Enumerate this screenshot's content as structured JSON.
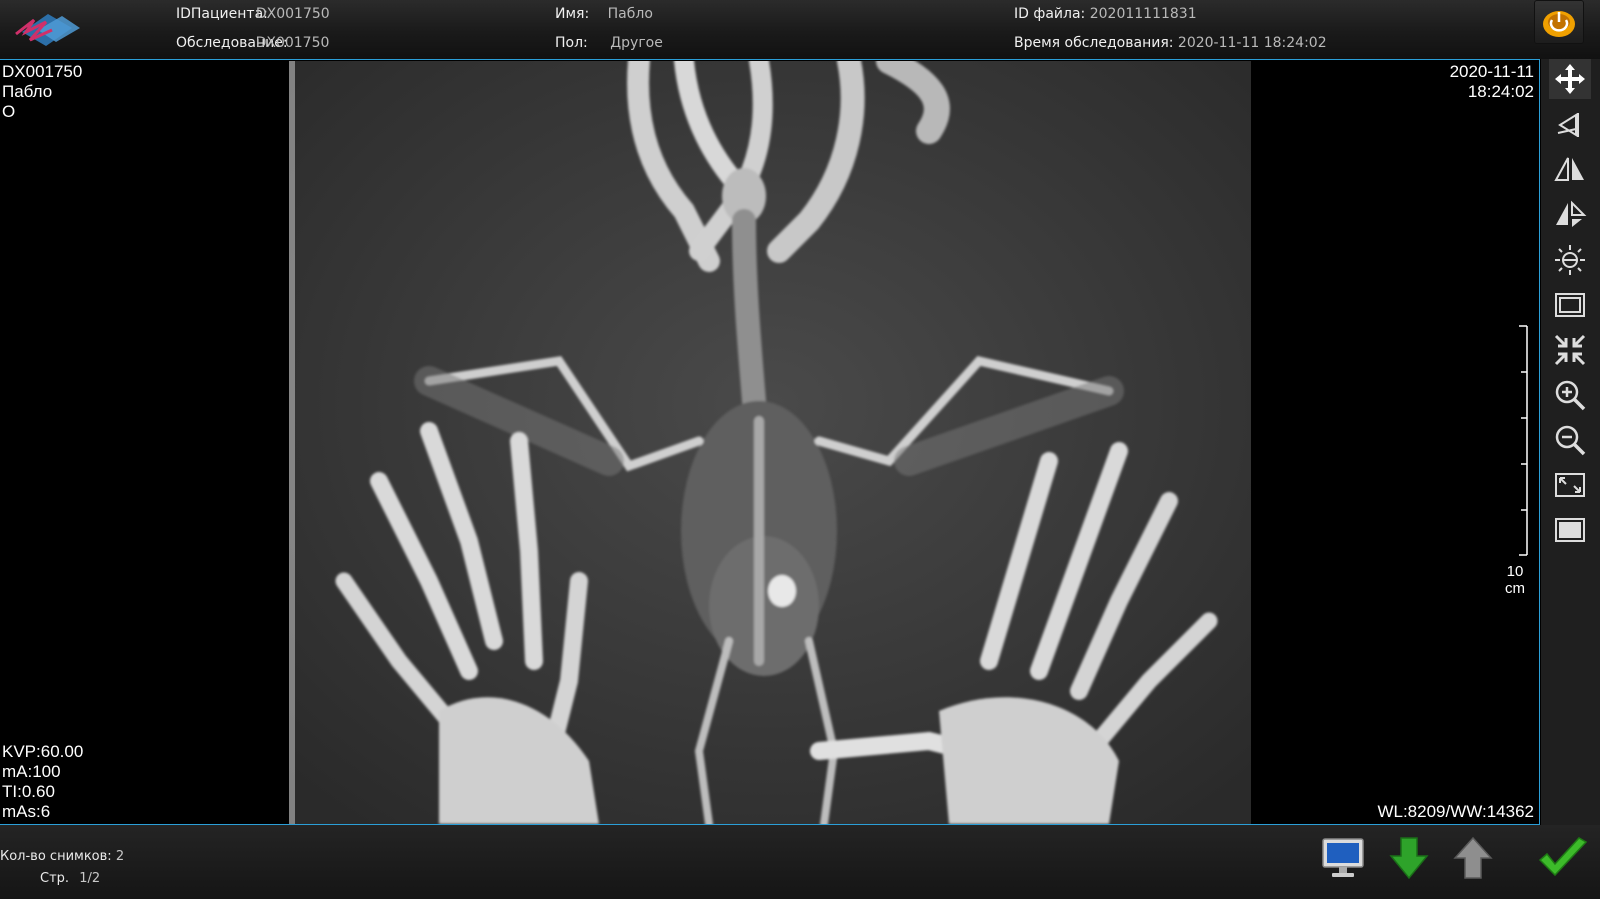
{
  "header": {
    "patient_id_label": "IDПациента:",
    "patient_id_value": "DX001750",
    "exam_label": "Обследование:",
    "exam_value": "DX001750",
    "name_label": "Имя:",
    "name_value": "Пабло",
    "sex_label": "Пол:",
    "sex_value": "Другое",
    "file_id_label": "ID файла:",
    "file_id_value": "202011111831",
    "exam_time_label": "Время обследования:",
    "exam_time_value": "2020-11-11 18:24:02"
  },
  "overlay": {
    "top_left": [
      "DX001750",
      "Пабло",
      "O"
    ],
    "top_right": [
      "2020-11-11",
      "18:24:02"
    ],
    "bottom_left": [
      "KVP:60.00",
      "mA:100",
      "TI:0.60",
      "mAs:6"
    ],
    "bottom_right": "WL:8209/WW:14362",
    "scale_value": "10",
    "scale_unit": "cm"
  },
  "toolbar": {
    "tools": [
      "move-icon",
      "rotate-icon",
      "flip-horizontal-icon",
      "flip-vertical-icon",
      "brightness-icon",
      "window-frame-icon",
      "fit-icon",
      "zoom-in-icon",
      "zoom-out-icon",
      "fullscreen-icon",
      "actual-size-icon"
    ]
  },
  "footer": {
    "count_label": "Кол-во снимков:",
    "count_value": "2",
    "page_label": "Стр.",
    "page_value": "1/2"
  },
  "colors": {
    "accent_border": "#2b9fd8",
    "header_bg": "#1c1c1c",
    "toolbar_bg": "#1f1f1f",
    "confirm_green": "#3dbb2a",
    "power_orange": "#f0a000"
  }
}
